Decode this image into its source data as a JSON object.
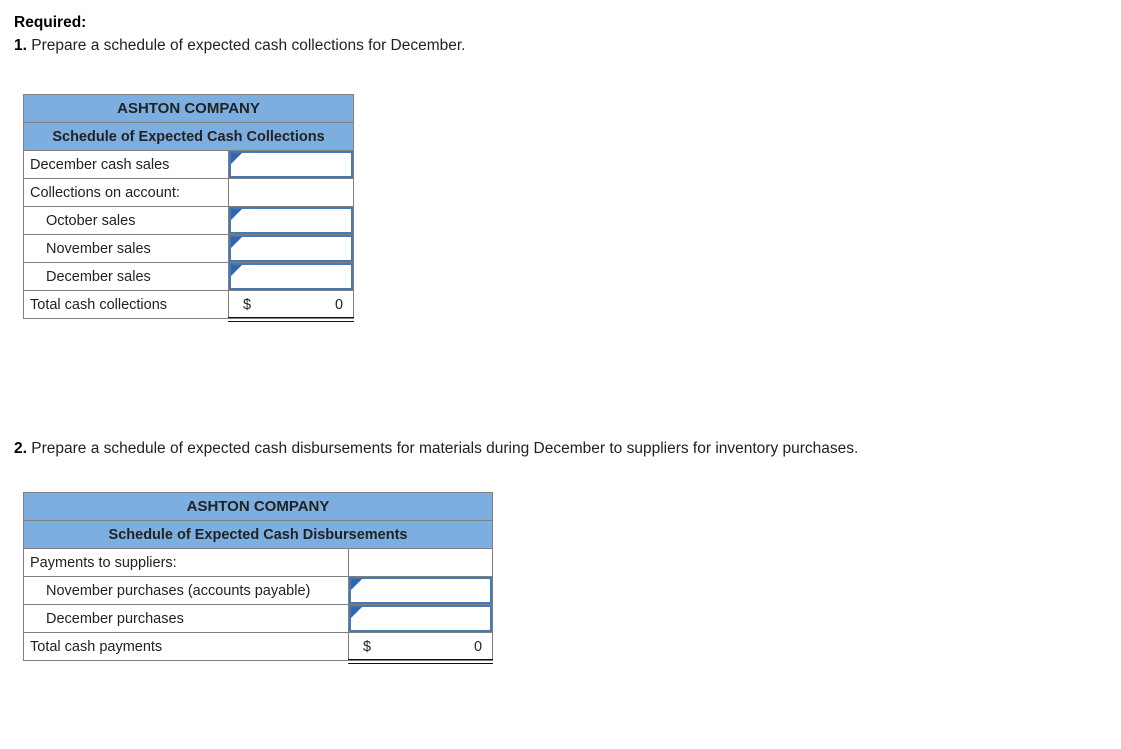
{
  "instructions": {
    "heading": "Required:",
    "item1_number": "1.",
    "item1_text": "Prepare a schedule of expected cash collections for December.",
    "item2_number": "2.",
    "item2_text": "Prepare a schedule of expected cash disbursements for materials during December to suppliers for inventory purchases."
  },
  "colors": {
    "header_blue": "#7CAEE0",
    "input_border_blue": "#4878B4",
    "input_marker_blue": "#2E66B0",
    "grid_gray": "#808080"
  },
  "collections_schedule": {
    "company": "ASHTON COMPANY",
    "subtitle": "Schedule of Expected Cash Collections",
    "rows": [
      {
        "label": "December cash sales",
        "indent": false,
        "type": "input",
        "value": ""
      },
      {
        "label": "Collections on account:",
        "indent": false,
        "type": "blank",
        "value": ""
      },
      {
        "label": "October sales",
        "indent": true,
        "type": "input",
        "value": ""
      },
      {
        "label": "November sales",
        "indent": true,
        "type": "input",
        "value": ""
      },
      {
        "label": "December sales",
        "indent": true,
        "type": "input",
        "value": ""
      }
    ],
    "total": {
      "label": "Total cash collections",
      "currency": "$",
      "amount": "0"
    }
  },
  "disbursements_schedule": {
    "company": "ASHTON COMPANY",
    "subtitle": "Schedule of Expected Cash Disbursements",
    "rows": [
      {
        "label": "Payments to suppliers:",
        "indent": false,
        "type": "blank",
        "value": ""
      },
      {
        "label": "November purchases (accounts payable)",
        "indent": true,
        "type": "input",
        "value": ""
      },
      {
        "label": "December purchases",
        "indent": true,
        "type": "input",
        "value": ""
      }
    ],
    "total": {
      "label": "Total cash payments",
      "currency": "$",
      "amount": "0"
    }
  }
}
